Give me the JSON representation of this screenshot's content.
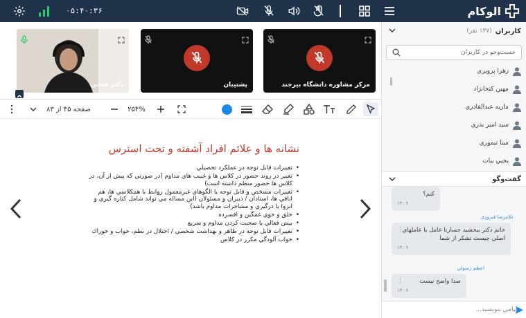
{
  "app": {
    "logo_text": "الوکام"
  },
  "topbar": {
    "timer": "۰۵:۴۰:۳۶"
  },
  "videos": [
    {
      "name": "دکتر فتحی",
      "kind": "camera"
    },
    {
      "name": "پشتیبان",
      "kind": "muted"
    },
    {
      "name": "مرکز مشاوره دانشگاه بیرجند",
      "kind": "muted"
    }
  ],
  "toolbar": {
    "page_label": "صفحه ۴۵ از ۸۳",
    "zoom": "۲۵۴%",
    "active_color": "#1e88e5"
  },
  "slide": {
    "title": "نشانه ها و علائم افراد آشفته و تحت استرس",
    "bullets": [
      "تغييرات قابل توجه در عملكرد تحصيلي",
      "تغيير در روند حضور در كلاس ها و غيبب هاي مداوم (در صورتي كه پيش از آن، در كلاس ها حضور منظم داشته است)",
      "تغييرات مشخص و قابل توجه يا الگوهاي غيرمعمول روابط با همكلاسي ها، هم اتاقي ها، استادان / دبيران و مسئولان (اين مساله مي تواند شامل كناره گيري و انزوا يا درگيري و مشاجرات مداوم باشد)",
      "خلق و خوي غمگين و افسرده",
      "بيش فعالي يا صحبت كردن مداوم و سريع",
      "تغييرات قابل توجه در ظاهر و بهداشت شخصي / اختلال در نظم، خواب و خوراك",
      "خواب آلودگي مكرر در كلاس"
    ]
  },
  "users_panel": {
    "title": "کاربران",
    "count": "(۱۳۷ نفر)",
    "search_placeholder": "جست‌وجو در کاربران",
    "users": [
      "زهرا پرويزي",
      "مهين كيخانژاد",
      "ماريه عبدالقادري",
      "سيد امير بدري",
      "مينا تيموري",
      "يحيي بيات"
    ]
  },
  "chat_panel": {
    "title": "گفت‌وگو",
    "messages": [
      {
        "sender": "",
        "text": "کنم؟",
        "time": "۱۳:۰۷"
      },
      {
        "sender": "غلامرضا فيروزي",
        "text": "خانم دکتر ببخشيد جسارتا عامل يا عاملهاي اصلي چيست تشکر از شما",
        "time": "۱۳:۰۷"
      },
      {
        "sender": "اعظم رسولي",
        "text": "صدا واضح نيست",
        "time": "۱۳:۰۷"
      }
    ],
    "input_placeholder": "پيامي بنويسيد..."
  }
}
